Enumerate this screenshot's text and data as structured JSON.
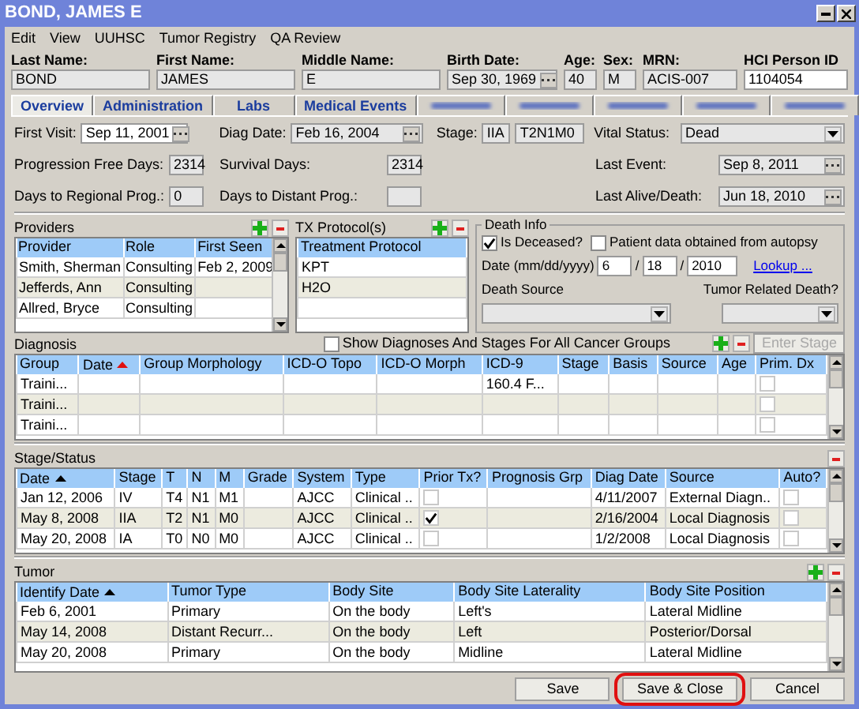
{
  "window": {
    "title": "BOND, JAMES E"
  },
  "menu": [
    {
      "label": "Edit"
    },
    {
      "label": "View"
    },
    {
      "label": "UUHSC"
    },
    {
      "label": "Tumor Registry"
    },
    {
      "label": "QA Review"
    }
  ],
  "header_fields": [
    {
      "label": "Last Name:",
      "value": "BOND",
      "kind": "text"
    },
    {
      "label": "First Name:",
      "value": "JAMES",
      "kind": "text"
    },
    {
      "label": "Middle Name:",
      "value": "E",
      "kind": "text"
    },
    {
      "label": "Birth Date:",
      "value": "Sep 30, 1969",
      "kind": "date"
    },
    {
      "label": "Age:",
      "value": "40",
      "kind": "short"
    },
    {
      "label": "Sex:",
      "value": "M",
      "kind": "short"
    },
    {
      "label": "MRN:",
      "value": "ACIS-007",
      "kind": "text"
    },
    {
      "label": "HCI Person ID",
      "value": "1104054",
      "kind": "plain"
    }
  ],
  "tabs": [
    {
      "label": "Overview",
      "selected": true,
      "kind": "text"
    },
    {
      "label": "Administration",
      "selected": false,
      "kind": "text"
    },
    {
      "label": "Labs",
      "selected": false,
      "kind": "text"
    },
    {
      "label": "Medical Events",
      "selected": false,
      "kind": "text"
    },
    {
      "selected": false,
      "kind": "blurred"
    },
    {
      "selected": false,
      "kind": "blurred"
    },
    {
      "selected": false,
      "kind": "blurred"
    },
    {
      "selected": false,
      "kind": "blurred"
    },
    {
      "selected": false,
      "kind": "blurred"
    }
  ],
  "overview": {
    "first_visit": {
      "label": "First Visit:",
      "value": "Sep 11, 2001"
    },
    "diag_date": {
      "label": "Diag Date:",
      "value": "Feb 16, 2004"
    },
    "stage": {
      "label": "Stage:",
      "values": [
        "IIA",
        "T2N1M0"
      ]
    },
    "vital_status": {
      "label": "Vital Status:",
      "value": "Dead"
    },
    "progression_free_days": {
      "label": "Progression Free Days:",
      "value": "2314"
    },
    "survival_days": {
      "label": "Survival Days:",
      "value": "2314"
    },
    "last_event": {
      "label": "Last Event:",
      "value": "Sep 8, 2011"
    },
    "days_to_regional_prog": {
      "label": "Days to Regional Prog.:",
      "value": "0"
    },
    "days_to_distant_prog": {
      "label": "Days to Distant Prog.:"
    },
    "last_alive_death": {
      "label": "Last Alive/Death:",
      "value": "Jun 18, 2010"
    }
  },
  "providers": {
    "title": "Providers",
    "columns": [
      {
        "label": "Provider",
        "sorted": false
      },
      {
        "label": "Role",
        "sorted": false
      },
      {
        "label": "First Seen",
        "sorted": false
      }
    ],
    "rows": [
      {
        "cells": [
          {
            "text": "Smith, Sherman"
          },
          {
            "text": "Consulting"
          },
          {
            "text": "Feb 2, 2009"
          }
        ]
      },
      {
        "cells": [
          {
            "text": "Jefferds, Ann"
          },
          {
            "text": "Consulting"
          },
          {}
        ]
      },
      {
        "cells": [
          {
            "text": "Allred, Bryce"
          },
          {
            "text": "Consulting"
          },
          {}
        ]
      }
    ]
  },
  "tx_protocols": {
    "title": "TX Protocol(s)",
    "columns": [
      {
        "label": "Treatment Protocol",
        "sorted": false
      }
    ],
    "rows": [
      {
        "cells": [
          {
            "text": "KPT"
          }
        ]
      },
      {
        "cells": [
          {
            "text": "H2O"
          }
        ]
      }
    ]
  },
  "death_info": {
    "title": "Death Info",
    "is_deceased": {
      "label": "Is Deceased?",
      "checked": true
    },
    "autopsy": {
      "label": "Patient data obtained from autopsy",
      "checked": false
    },
    "date": {
      "label": "Date (mm/dd/yyyy)",
      "month": "6",
      "day": "18",
      "year": "2010",
      "separators": [
        "/",
        "/"
      ]
    },
    "lookup": "Lookup ...",
    "death_source": {
      "label": "Death Source"
    },
    "tumor_related": {
      "label": "Tumor Related Death?"
    }
  },
  "diagnosis": {
    "title": "Diagnosis",
    "show_all": {
      "label": "Show Diagnoses And Stages For All Cancer Groups",
      "checked": false
    },
    "enter_stage": {
      "label": "Enter Stage",
      "disabled": true
    },
    "columns": [
      {
        "label": "Group",
        "sorted": false
      },
      {
        "label": "Date",
        "sorted": true
      },
      {
        "label": "Group Morphology",
        "sorted": false
      },
      {
        "label": "ICD-O Topo",
        "sorted": false
      },
      {
        "label": "ICD-O Morph",
        "sorted": false
      },
      {
        "label": "ICD-9",
        "sorted": false
      },
      {
        "label": "Stage",
        "sorted": false
      },
      {
        "label": "Basis",
        "sorted": false
      },
      {
        "label": "Source",
        "sorted": false
      },
      {
        "label": "Age",
        "sorted": false
      },
      {
        "label": "Prim. Dx",
        "sorted": false
      }
    ],
    "rows": [
      {
        "cells": [
          {
            "text": "Traini..."
          },
          {},
          {},
          {},
          {},
          {
            "text": "160.4 F..."
          },
          {},
          {},
          {},
          {},
          {
            "checked": false
          }
        ]
      },
      {
        "cells": [
          {
            "text": "Traini..."
          },
          {},
          {},
          {},
          {},
          {},
          {},
          {},
          {},
          {},
          {
            "checked": false
          }
        ]
      },
      {
        "cells": [
          {
            "text": "Traini..."
          },
          {},
          {},
          {},
          {},
          {},
          {},
          {},
          {},
          {},
          {
            "checked": false
          }
        ]
      }
    ]
  },
  "stage_status": {
    "title": "Stage/Status",
    "columns": [
      {
        "label": "Date",
        "sorted": true
      },
      {
        "label": "Stage",
        "sorted": false
      },
      {
        "label": "T",
        "sorted": false
      },
      {
        "label": "N",
        "sorted": false
      },
      {
        "label": "M",
        "sorted": false
      },
      {
        "label": "Grade",
        "sorted": false
      },
      {
        "label": "System",
        "sorted": false
      },
      {
        "label": "Type",
        "sorted": false
      },
      {
        "label": "Prior Tx?",
        "sorted": false
      },
      {
        "label": "Prognosis Grp",
        "sorted": false
      },
      {
        "label": "Diag Date",
        "sorted": false
      },
      {
        "label": "Source",
        "sorted": false
      },
      {
        "label": "Auto?",
        "sorted": false
      }
    ],
    "rows": [
      {
        "cells": [
          {
            "text": "Jan 12, 2006"
          },
          {
            "text": "IV"
          },
          {
            "text": "T4"
          },
          {
            "text": "N1"
          },
          {
            "text": "M1"
          },
          {},
          {
            "text": "AJCC"
          },
          {
            "text": "Clinical .."
          },
          {
            "checked": false
          },
          {},
          {
            "text": "4/11/2007"
          },
          {
            "text": "External Diagn.."
          },
          {
            "checked": false
          }
        ]
      },
      {
        "cells": [
          {
            "text": "May 8, 2008"
          },
          {
            "text": "IIA"
          },
          {
            "text": "T2"
          },
          {
            "text": "N1"
          },
          {
            "text": "M0"
          },
          {},
          {
            "text": "AJCC"
          },
          {
            "text": "Clinical .."
          },
          {
            "checked": true
          },
          {},
          {
            "text": "2/16/2004"
          },
          {
            "text": "Local Diagnosis"
          },
          {
            "checked": false
          }
        ]
      },
      {
        "cells": [
          {
            "text": "May 20, 2008"
          },
          {
            "text": "IA"
          },
          {
            "text": "T0"
          },
          {
            "text": "N0"
          },
          {
            "text": "M0"
          },
          {},
          {
            "text": "AJCC"
          },
          {
            "text": "Clinical .."
          },
          {
            "checked": false
          },
          {},
          {
            "text": "1/2/2008"
          },
          {
            "text": "Local Diagnosis"
          },
          {
            "checked": false
          }
        ]
      }
    ]
  },
  "tumor": {
    "title": "Tumor",
    "columns": [
      {
        "label": "Identify Date",
        "sorted": true
      },
      {
        "label": "Tumor Type",
        "sorted": false
      },
      {
        "label": "Body Site",
        "sorted": false
      },
      {
        "label": "Body Site Laterality",
        "sorted": false
      },
      {
        "label": "Body Site Position",
        "sorted": false
      }
    ],
    "rows": [
      {
        "cells": [
          {
            "text": "Feb 6, 2001"
          },
          {
            "text": "Primary"
          },
          {
            "text": "On the body"
          },
          {
            "text": "Left's"
          },
          {
            "text": "Lateral Midline"
          }
        ]
      },
      {
        "cells": [
          {
            "text": "May 14, 2008"
          },
          {
            "text": "Distant Recurr..."
          },
          {
            "text": "On the body"
          },
          {
            "text": "Left"
          },
          {
            "text": "Posterior/Dorsal"
          }
        ]
      },
      {
        "cells": [
          {
            "text": "May 20, 2008"
          },
          {
            "text": "Primary"
          },
          {
            "text": "On the body"
          },
          {
            "text": "Midline"
          },
          {
            "text": "Lateral Midline"
          }
        ]
      }
    ]
  },
  "buttons": [
    {
      "label": "Save",
      "highlighted": false
    },
    {
      "label": "Save & Close",
      "highlighted": true
    },
    {
      "label": "Cancel",
      "highlighted": false
    }
  ]
}
